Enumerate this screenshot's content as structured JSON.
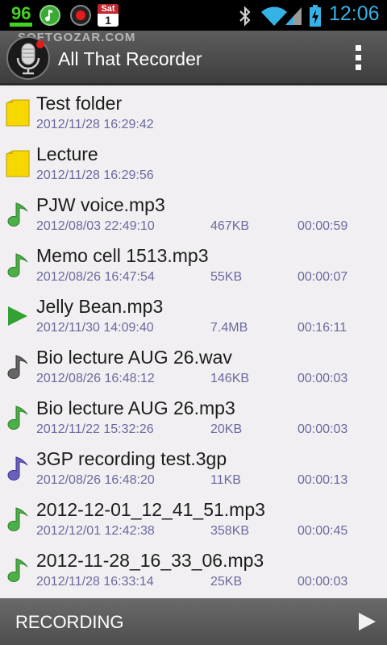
{
  "status_bar": {
    "battery_level": "96",
    "calendar_day": "Sat",
    "calendar_date": "1",
    "time": "12:06",
    "icons": [
      "music-icon",
      "record-icon",
      "calendar-icon",
      "bluetooth-icon",
      "wifi-icon",
      "signal-icon",
      "battery-icon"
    ]
  },
  "action_bar": {
    "title": "All That Recorder",
    "watermark": "SOFTGOZAR.COM"
  },
  "files": [
    {
      "name": "Test folder",
      "date": "2012/11/28 16:29:42",
      "size": "",
      "duration": "",
      "type": "folder"
    },
    {
      "name": "Lecture",
      "date": "2012/11/28 16:29:56",
      "size": "",
      "duration": "",
      "type": "folder"
    },
    {
      "name": "PJW voice.mp3",
      "date": "2012/08/03 22:49:10",
      "size": "467KB",
      "duration": "00:00:59",
      "type": "audio-green"
    },
    {
      "name": "Memo cell 1513.mp3",
      "date": "2012/08/26 16:47:54",
      "size": "55KB",
      "duration": "00:00:07",
      "type": "audio-green"
    },
    {
      "name": "Jelly Bean.mp3",
      "date": "2012/11/30 14:09:40",
      "size": "7.4MB",
      "duration": "00:16:11",
      "type": "playing"
    },
    {
      "name": "Bio lecture AUG 26.wav",
      "date": "2012/08/26 16:48:12",
      "size": "146KB",
      "duration": "00:00:03",
      "type": "audio-gray"
    },
    {
      "name": "Bio lecture AUG 26.mp3",
      "date": "2012/11/22 15:32:26",
      "size": "20KB",
      "duration": "00:00:03",
      "type": "audio-green"
    },
    {
      "name": "3GP recording test.3gp",
      "date": "2012/08/26 16:48:20",
      "size": "11KB",
      "duration": "00:00:13",
      "type": "audio-purple"
    },
    {
      "name": "2012-12-01_12_41_51.mp3",
      "date": "2012/12/01 12:42:38",
      "size": "358KB",
      "duration": "00:00:45",
      "type": "audio-green"
    },
    {
      "name": "2012-11-28_16_33_06.mp3",
      "date": "2012/11/28 16:33:14",
      "size": "25KB",
      "duration": "00:00:03",
      "type": "audio-green"
    }
  ],
  "bottom_bar": {
    "recording_label": "RECORDING"
  },
  "colors": {
    "accent_time": "#35b2e6",
    "meta_text": "#6b6a9f",
    "battery_green": "#45d21f"
  }
}
